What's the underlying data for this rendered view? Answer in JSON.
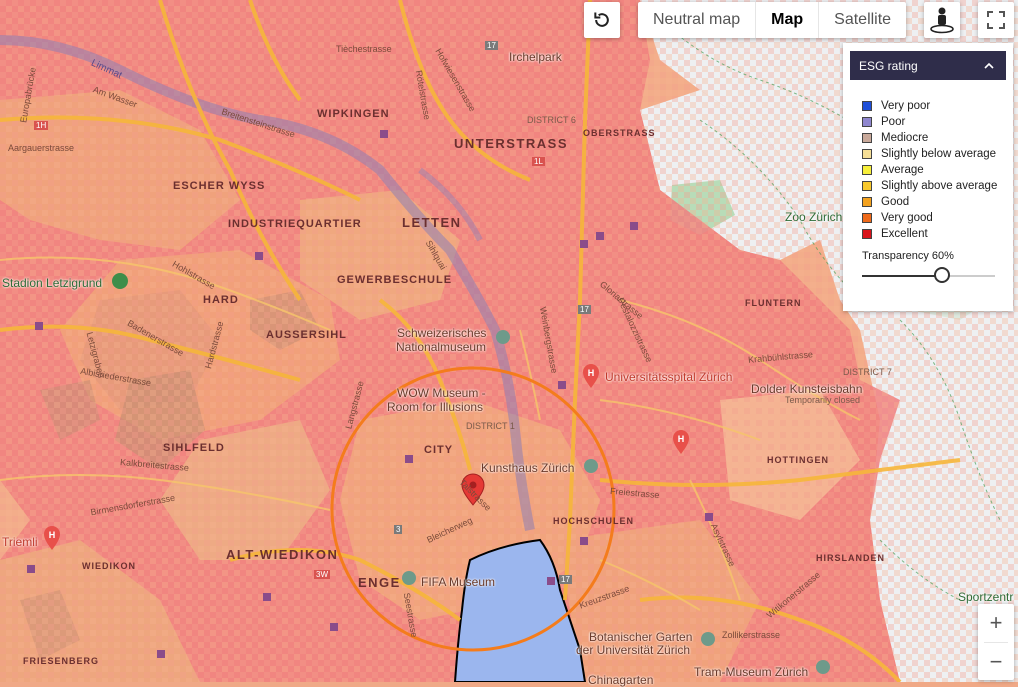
{
  "map_controls": {
    "map_types": [
      "Neutral map",
      "Map",
      "Satellite"
    ],
    "active_map_type": "Map",
    "reset_icon": "rotate-ccw-icon",
    "pegman_icon": "street-view-person-icon",
    "fullscreen_icon": "fullscreen-icon",
    "zoom_in": "+",
    "zoom_out": "−"
  },
  "legend": {
    "title": "ESG rating",
    "toggle_icon": "chevron-up-icon",
    "items": [
      {
        "label": "Very poor",
        "color": "#1f4fd8"
      },
      {
        "label": "Poor",
        "color": "#8f87cf"
      },
      {
        "label": "Mediocre",
        "color": "#c9a99a"
      },
      {
        "label": "Slightly below average",
        "color": "#f5de96"
      },
      {
        "label": "Average",
        "color": "#f7ef3a"
      },
      {
        "label": "Slightly above average",
        "color": "#f8c92e"
      },
      {
        "label": "Good",
        "color": "#f4a21e"
      },
      {
        "label": "Very good",
        "color": "#ef6a1a"
      },
      {
        "label": "Excellent",
        "color": "#d8141b"
      }
    ],
    "transparency_label": "Transparency 60%",
    "transparency_value": 0.6
  },
  "map_labels": {
    "districts": [
      "UNTERSTRASS",
      "LETTEN",
      "WIPKINGEN",
      "ESCHER WYSS",
      "INDUSTRIEQUARTIER",
      "GEWERBESCHULE",
      "HARD",
      "AUSSERSIHL",
      "SIHLFELD",
      "CITY",
      "DISTRICT 1",
      "DISTRICT 6",
      "DISTRICT 7",
      "OBERSTRASS",
      "ALT-WIEDIKON",
      "WIEDIKON",
      "ENGE",
      "HOCHSCHULEN",
      "HOTTINGEN",
      "FLUNTERN",
      "HIRSLANDEN",
      "FRIESENBERG"
    ],
    "pois": [
      "Irchelpark",
      "Zoo Zürich",
      "Stadion Letzigrund",
      "Schweizerisches",
      "Nationalmuseum",
      "WOW Museum -",
      "Room for Illusions",
      "Universitätsspital Zürich",
      "Kunsthaus Zürich",
      "Dolder Kunsteisbahn",
      "Temporarily closed",
      "Triemli",
      "FIFA Museum",
      "Botanischer Garten",
      "der Universität Zürich",
      "Tram-Museum Zürich",
      "Chinagarten",
      "Sportzentr"
    ],
    "streets": [
      "Limmat",
      "Am Wasser",
      "Europabrücke",
      "Aargauerstrasse",
      "Breitensteinstrasse",
      "Tièchestrasse",
      "Hofwiesenstrasse",
      "Rötelstrasse",
      "Hohlstrasse",
      "Badenerstrasse",
      "Albisriederstrasse",
      "Birmensdorferstrasse",
      "Letzigraben",
      "Hardstrasse",
      "Langstrasse",
      "Sihlquai",
      "Weinbergstrasse",
      "Krahbühlstrasse",
      "Gloriastrasse",
      "Pestalozzistrasse",
      "Bleicherweg",
      "Talstrasse",
      "Seestrasse",
      "Kreuzstrasse",
      "Asylstrasse",
      "Witikonerstrasse",
      "Zollikerstrasse",
      "Freiestrasse",
      "Kalkbreitestrasse"
    ],
    "road_badges": [
      "17",
      "1L",
      "1H",
      "3W",
      "3"
    ]
  }
}
